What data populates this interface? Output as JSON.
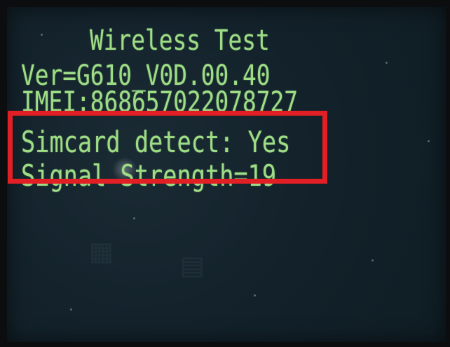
{
  "screen": {
    "title": "Wireless Test",
    "version_line": "Ver=G610_V0D.00.40",
    "imei_line": "IMEI:868657022078727",
    "simcard_line": "Simcard detect: Yes",
    "signal_line": "Signal Strength=19"
  },
  "colors": {
    "lcd_background": "#13222b",
    "text": "#9edc86",
    "highlight": "#e11f25"
  }
}
